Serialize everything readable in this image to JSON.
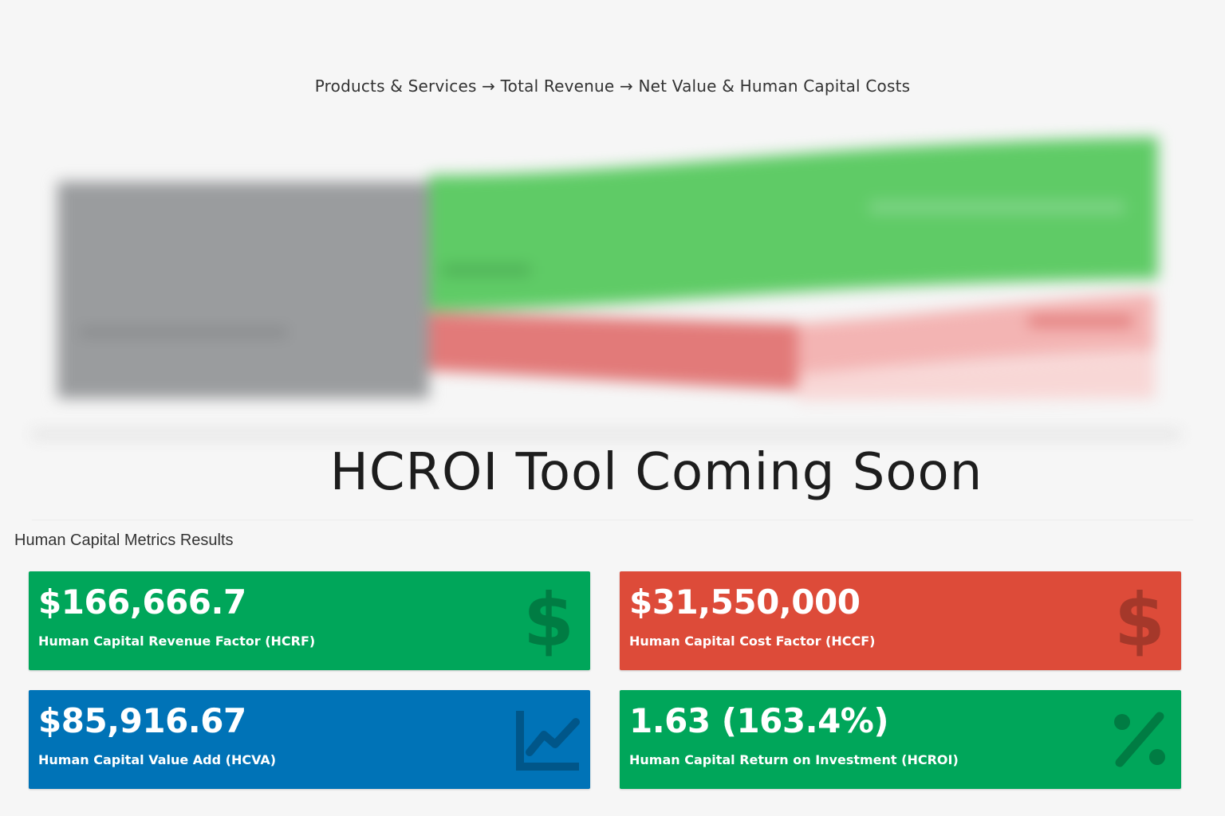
{
  "sankey": {
    "caption": "Products & Services → Total Revenue → Net Value & Human Capital Costs",
    "colors": {
      "products": "#9a9c9e",
      "net_value": "#5fcb66",
      "costs": "#e27a79",
      "costs_light": "#f3b4b3"
    }
  },
  "overlay": {
    "title": "HCROI Tool Coming Soon"
  },
  "metrics": {
    "heading": "Human Capital Metrics Results",
    "cards": [
      {
        "value": "$166,666.7",
        "label": "Human Capital Revenue Factor (HCRF)",
        "icon": "dollar-icon",
        "color": "#00a65a"
      },
      {
        "value": "$31,550,000",
        "label": "Human Capital Cost Factor (HCCF)",
        "icon": "dollar-icon",
        "color": "#dd4b39"
      },
      {
        "value": "$85,916.67",
        "label": "Human Capital Value Add (HCVA)",
        "icon": "line-chart-icon",
        "color": "#0073b7"
      },
      {
        "value": "1.63 (163.4%)",
        "label": "Human Capital Return on Investment (HCROI)",
        "icon": "percent-icon",
        "color": "#00a65a"
      }
    ]
  }
}
